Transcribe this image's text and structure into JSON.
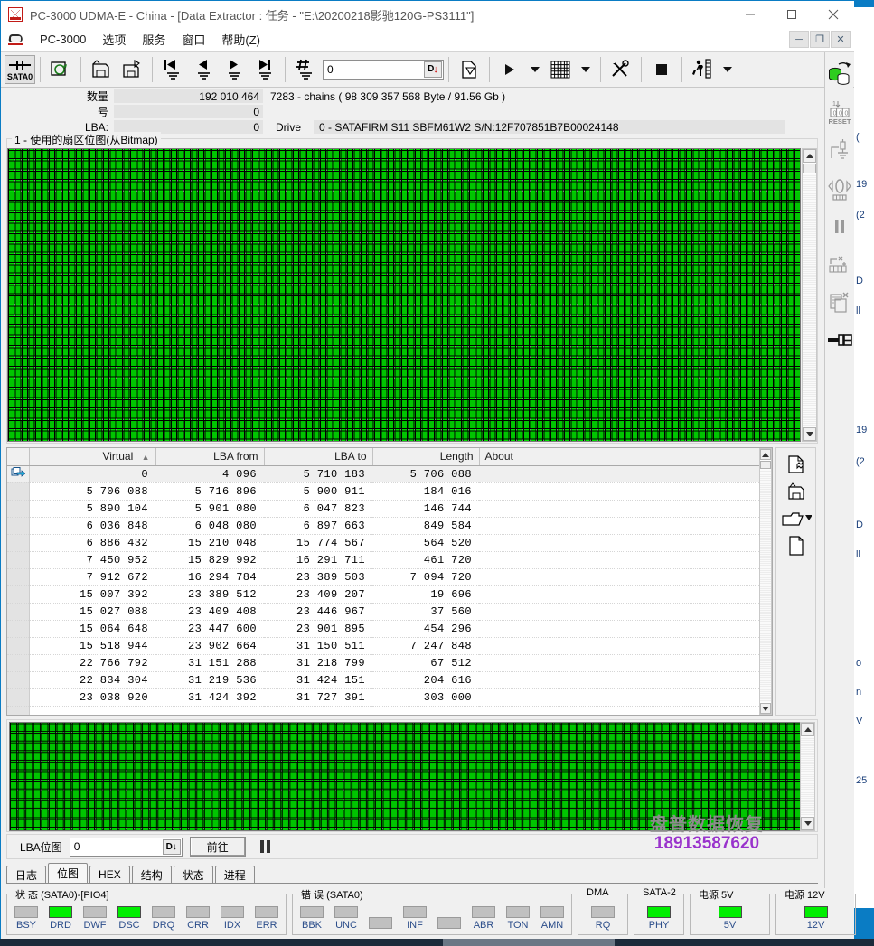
{
  "window": {
    "title": "PC-3000 UDMA-E - China - [Data Extractor : 任务 - \"E:\\20200218影驰120G-PS3111\"]",
    "app_icon": "pc3000-icon",
    "minimize": "−",
    "maximize": "□",
    "close": "✕"
  },
  "mdi_buttons": {
    "minimize": "─",
    "restore": "❐",
    "close": "✕"
  },
  "menu": {
    "icon": "pc3000-menu-icon",
    "items": [
      {
        "label": "PC-3000"
      },
      {
        "label": "选项"
      },
      {
        "label": "服务"
      },
      {
        "label": "窗口"
      },
      {
        "label": "帮助(Z)"
      }
    ]
  },
  "toolbar": {
    "buttons": [
      {
        "name": "sata0-port-button",
        "label": "SATA0"
      },
      {
        "name": "refresh-drive-button",
        "label": ""
      },
      {
        "name": "save-task-button",
        "label": ""
      },
      {
        "name": "save-as-task-button",
        "label": ""
      },
      {
        "name": "first-record-button",
        "label": ""
      },
      {
        "name": "prev-record-button",
        "label": ""
      },
      {
        "name": "next-record-button",
        "label": ""
      },
      {
        "name": "last-record-button",
        "label": ""
      },
      {
        "name": "goto-number-button",
        "label": ""
      }
    ],
    "number_input": {
      "value": "0",
      "placeholder": "0",
      "dec_button": "D"
    },
    "new_task_button": "",
    "run_button": "▶",
    "run_dropdown": "▼",
    "grid_button": "",
    "grid_dropdown": "▼",
    "tools_button": "",
    "stop_button": "■",
    "run_man_button": "",
    "run_man_dropdown": "▼"
  },
  "info": {
    "rows": [
      {
        "label": "数量",
        "value": "192 010 464",
        "extra": "7283 - chains   ( 98 309 357 568 Byte /  91.56 Gb )"
      },
      {
        "label": "号",
        "value": "0",
        "extra": ""
      },
      {
        "label": "LBA:",
        "value": "0",
        "extra_label": "Drive",
        "extra": "0 - SATAFIRM   S11 SBFM61W2 S/N:12F707851B7B00024148"
      }
    ]
  },
  "bitmap_panel": {
    "title": "1 - 使用的扇区位图(从Bitmap)",
    "cell_color": "#00e000",
    "background": "#ffffff"
  },
  "table": {
    "columns": [
      {
        "key": "marker",
        "label": ""
      },
      {
        "key": "virtual",
        "label": "Virtual",
        "sort": "▲"
      },
      {
        "key": "lba_from",
        "label": "LBA from"
      },
      {
        "key": "lba_to",
        "label": "LBA to"
      },
      {
        "key": "length",
        "label": "Length"
      },
      {
        "key": "about",
        "label": "About"
      }
    ],
    "rows": [
      {
        "virtual": "0",
        "lba_from": "4 096",
        "lba_to": "5 710 183",
        "length": "5 706 088",
        "about": "",
        "current": true
      },
      {
        "virtual": "5 706 088",
        "lba_from": "5 716 896",
        "lba_to": "5 900 911",
        "length": "184 016",
        "about": ""
      },
      {
        "virtual": "5 890 104",
        "lba_from": "5 901 080",
        "lba_to": "6 047 823",
        "length": "146 744",
        "about": ""
      },
      {
        "virtual": "6 036 848",
        "lba_from": "6 048 080",
        "lba_to": "6 897 663",
        "length": "849 584",
        "about": ""
      },
      {
        "virtual": "6 886 432",
        "lba_from": "15 210 048",
        "lba_to": "15 774 567",
        "length": "564 520",
        "about": ""
      },
      {
        "virtual": "7 450 952",
        "lba_from": "15 829 992",
        "lba_to": "16 291 711",
        "length": "461 720",
        "about": ""
      },
      {
        "virtual": "7 912 672",
        "lba_from": "16 294 784",
        "lba_to": "23 389 503",
        "length": "7 094 720",
        "about": ""
      },
      {
        "virtual": "15 007 392",
        "lba_from": "23 389 512",
        "lba_to": "23 409 207",
        "length": "19 696",
        "about": ""
      },
      {
        "virtual": "15 027 088",
        "lba_from": "23 409 408",
        "lba_to": "23 446 967",
        "length": "37 560",
        "about": ""
      },
      {
        "virtual": "15 064 648",
        "lba_from": "23 447 600",
        "lba_to": "23 901 895",
        "length": "454 296",
        "about": ""
      },
      {
        "virtual": "15 518 944",
        "lba_from": "23 902 664",
        "lba_to": "31 150 511",
        "length": "7 247 848",
        "about": ""
      },
      {
        "virtual": "22 766 792",
        "lba_from": "31 151 288",
        "lba_to": "31 218 799",
        "length": "67 512",
        "about": ""
      },
      {
        "virtual": "22 834 304",
        "lba_from": "31 219 536",
        "lba_to": "31 424 151",
        "length": "204 616",
        "about": ""
      },
      {
        "virtual": "23 038 920",
        "lba_from": "31 424 392",
        "lba_to": "31 727 391",
        "length": "303 000",
        "about": ""
      }
    ]
  },
  "list_tools": [
    {
      "name": "add-map-button"
    },
    {
      "name": "save-map-button"
    },
    {
      "name": "open-map-button"
    },
    {
      "name": "new-map-button"
    }
  ],
  "watermark": {
    "line1": "盘普数据恢复",
    "line2": "18913587620"
  },
  "lba_bar": {
    "label": "LBA位图",
    "input_value": "0",
    "dec_button": "D",
    "goto_label": "前往",
    "pause_icon": "pause-icon"
  },
  "tabs": [
    {
      "label": "日志",
      "active": false
    },
    {
      "label": "位图",
      "active": true
    },
    {
      "label": "HEX",
      "active": false
    },
    {
      "label": "结构",
      "active": false
    },
    {
      "label": "状态",
      "active": false
    },
    {
      "label": "进程",
      "active": false
    }
  ],
  "status_groups": [
    {
      "title": "状 态 (SATA0)-[PIO4]",
      "leds": [
        {
          "label": "BSY",
          "on": false
        },
        {
          "label": "DRD",
          "on": true
        },
        {
          "label": "DWF",
          "on": false
        },
        {
          "label": "DSC",
          "on": true
        },
        {
          "label": "DRQ",
          "on": false
        },
        {
          "label": "CRR",
          "on": false
        },
        {
          "label": "IDX",
          "on": false
        },
        {
          "label": "ERR",
          "on": false
        }
      ]
    },
    {
      "title": "错 误 (SATA0)",
      "leds": [
        {
          "label": "BBK",
          "on": false
        },
        {
          "label": "UNC",
          "on": false
        },
        {
          "label": "",
          "on": false,
          "blank": true
        },
        {
          "label": "INF",
          "on": false
        },
        {
          "label": "",
          "on": false,
          "blank": true
        },
        {
          "label": "ABR",
          "on": false
        },
        {
          "label": "TON",
          "on": false
        },
        {
          "label": "AMN",
          "on": false
        }
      ]
    },
    {
      "title": "DMA",
      "leds": [
        {
          "label": "RQ",
          "on": false
        }
      ]
    },
    {
      "title": "SATA-2",
      "leds": [
        {
          "label": "PHY",
          "on": true
        }
      ]
    },
    {
      "title": "电源 5V",
      "leds": [
        {
          "label": "5V",
          "on": true
        }
      ]
    },
    {
      "title": "电源 12V",
      "leds": [
        {
          "label": "12V",
          "on": true
        }
      ]
    }
  ],
  "background_window": {
    "fragments": [
      "(",
      "19",
      "(2",
      "D",
      "ll",
      "o",
      "n",
      "V",
      "25"
    ]
  },
  "colors": {
    "accent": "#0a7cc4",
    "led_on": "#00ee00",
    "led_off": "#c0c0c0",
    "bitmap_used": "#00e000",
    "watermark_phone": "#9933cc"
  }
}
